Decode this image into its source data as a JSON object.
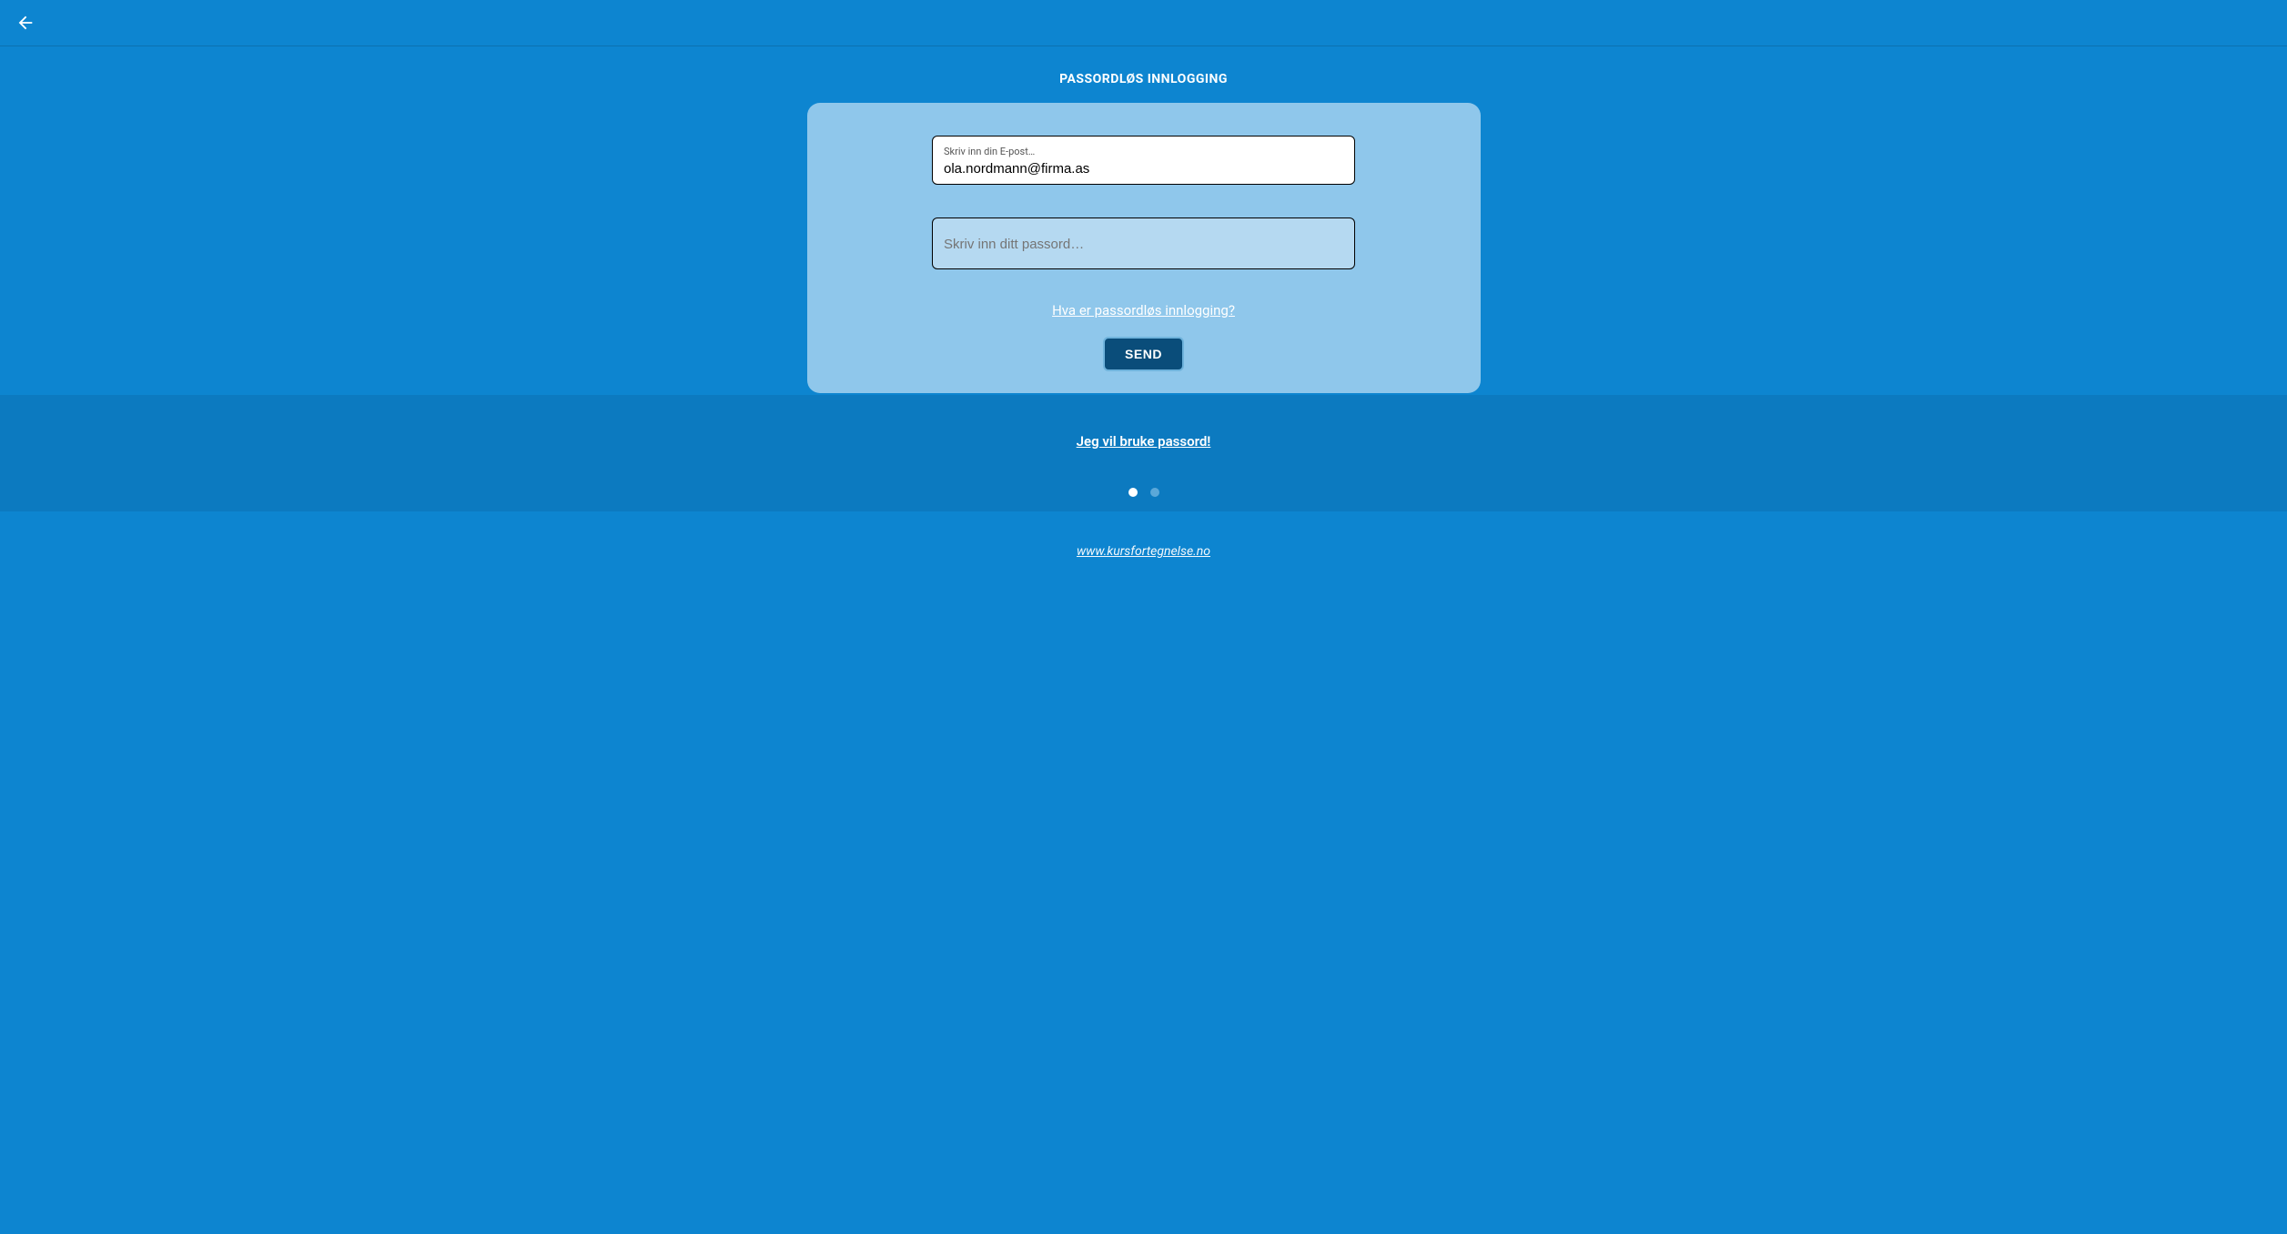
{
  "header": {
    "back_icon": "arrow-left"
  },
  "page": {
    "title": "PASSORDLØS INNLOGGING"
  },
  "form": {
    "email": {
      "label": "Skriv inn din E-post…",
      "value": "ola.nordmann@firma.as"
    },
    "password": {
      "placeholder": "Skriv inn ditt passord…"
    },
    "help_link": "Hva er passordløs innlogging?",
    "submit_label": "SEND"
  },
  "alt": {
    "password_link": "Jeg vil bruke passord!"
  },
  "pagination": {
    "total": 2,
    "active": 0
  },
  "footer": {
    "site_link": "www.kursfortegnelse.no"
  }
}
